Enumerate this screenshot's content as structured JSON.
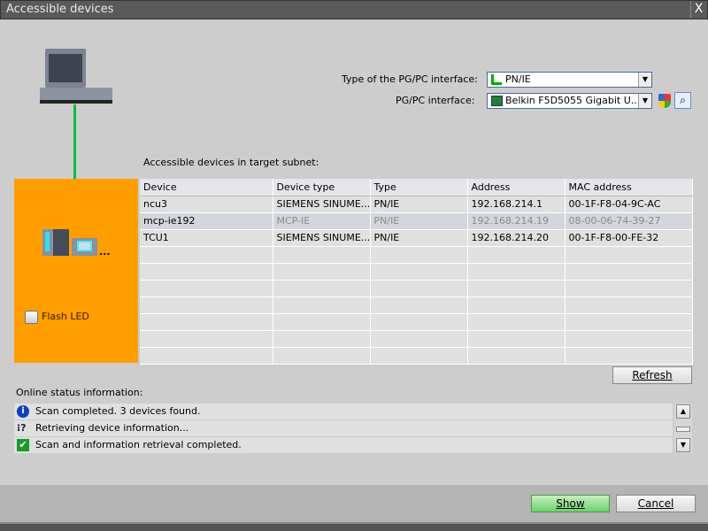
{
  "window": {
    "title": "Accessible devices",
    "close": "X"
  },
  "interface": {
    "type_label": "Type of the PG/PC interface:",
    "type_value": "PN/IE",
    "pgpc_label": "PG/PC interface:",
    "pgpc_value": "Belkin F5D5055 Gigabit U..."
  },
  "devices": {
    "heading": "Accessible devices in target subnet:",
    "flash_led": "Flash LED",
    "more": "...",
    "columns": [
      "Device",
      "Device type",
      "Type",
      "Address",
      "MAC address"
    ],
    "rows": [
      [
        "ncu3",
        "SIEMENS SINUME...",
        "PN/IE",
        "192.168.214.1",
        "00-1F-F8-04-9C-AC"
      ],
      [
        "mcp-ie192",
        "MCP-IE",
        "PN/IE",
        "192.168.214.19",
        "08-00-06-74-39-27"
      ],
      [
        "TCU1",
        "SIEMENS SINUME...",
        "PN/IE",
        "192.168.214.20",
        "00-1F-F8-00-FE-32"
      ]
    ]
  },
  "refresh": "Refresh",
  "status": {
    "label": "Online status information:",
    "messages": [
      {
        "icon": "info-icon",
        "text": "Scan completed. 3 devices found."
      },
      {
        "icon": "network-query-icon",
        "text": "Retrieving device information..."
      },
      {
        "icon": "check-icon",
        "text": "Scan and information retrieval completed."
      }
    ]
  },
  "footer": {
    "show": "Show",
    "cancel": "Cancel"
  },
  "colors": {
    "orange": "#ff9e00",
    "green_line": "#00c040"
  }
}
